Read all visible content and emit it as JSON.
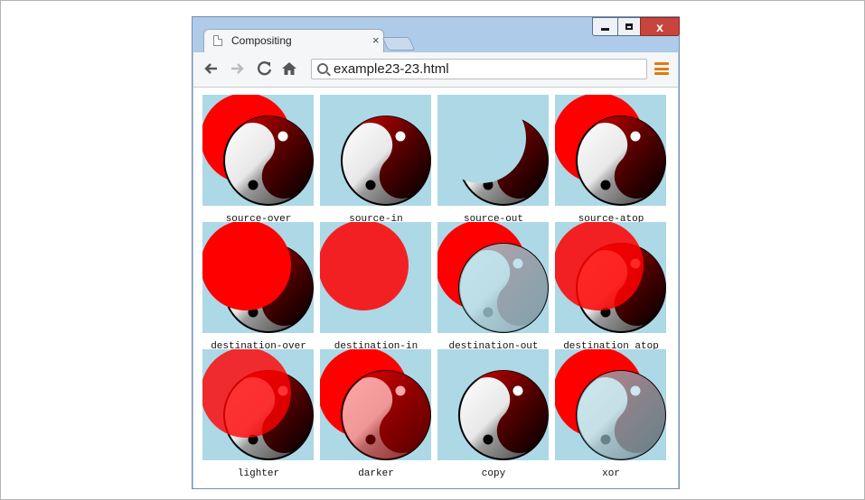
{
  "browser": {
    "tab_title": "Compositing",
    "tab_close": "×",
    "url": "example23-23.html",
    "window_controls": {
      "close": "x"
    },
    "icons": [
      "page-icon",
      "back-icon",
      "forward-icon",
      "reload-icon",
      "home-icon",
      "search-icon",
      "menu-icon"
    ]
  },
  "demo": {
    "tiles": [
      {
        "label": "source-over"
      },
      {
        "label": "source-in"
      },
      {
        "label": "source-out"
      },
      {
        "label": "source-atop"
      },
      {
        "label": "destination-over"
      },
      {
        "label": "destination-in"
      },
      {
        "label": "destination-out"
      },
      {
        "label": "destination atop"
      },
      {
        "label": "lighter"
      },
      {
        "label": "darker"
      },
      {
        "label": "copy"
      },
      {
        "label": "xor"
      }
    ],
    "colors": {
      "background": "#add8e6",
      "circle": "#ff0000",
      "yin_dark": "#000000",
      "yin_light": "#ffffff"
    }
  }
}
